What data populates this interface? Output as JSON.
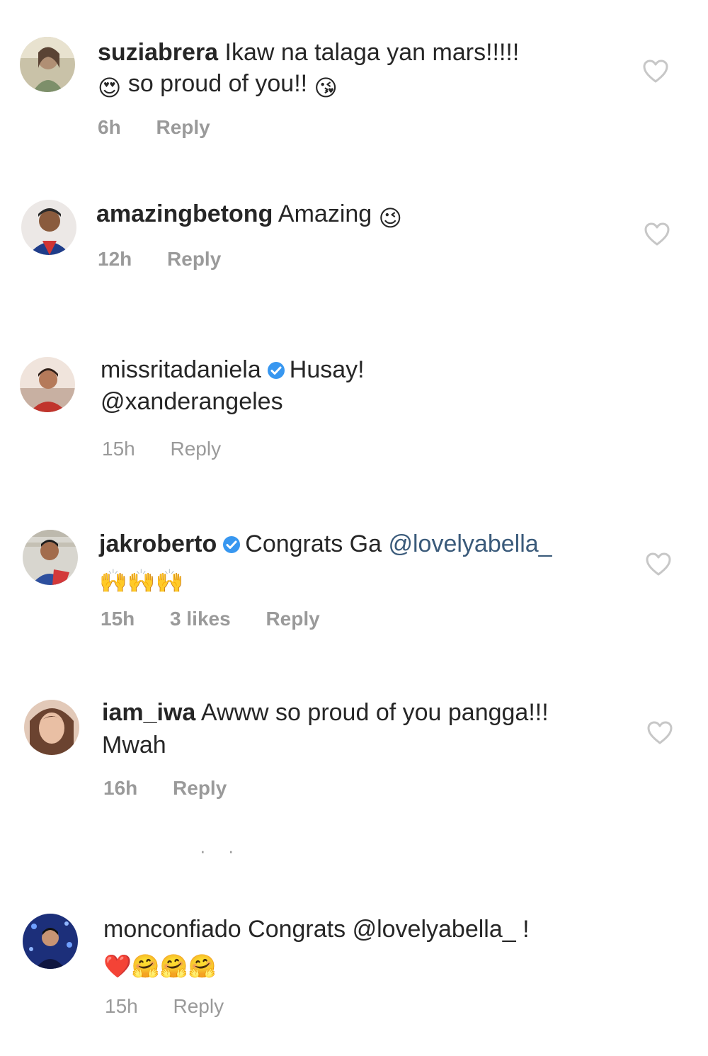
{
  "comments": [
    {
      "username": "suziabrera",
      "text_line1": "Ikaw na talaga yan mars!!!!!",
      "emoji_before": "😍",
      "text_line2": "so proud of you!!",
      "emoji_after": "😘",
      "time": "6h",
      "reply": "Reply"
    },
    {
      "username": "amazingbetong",
      "text_line1": "Amazing",
      "emoji_after": "😉",
      "time": "12h",
      "reply": "Reply"
    },
    {
      "username": "missritadaniela",
      "text_line1": "Husay!",
      "mention": "@xanderangeles",
      "time": "15h",
      "reply": "Reply"
    },
    {
      "username": "jakroberto",
      "text_line1": "Congrats Ga",
      "mention": "@lovelyabella_",
      "emoji_line2": "🙌🙌🙌",
      "time": "15h",
      "likes": "3 likes",
      "reply": "Reply"
    },
    {
      "username": "iam_iwa",
      "text_line1": "Awww so proud of you pangga!!!",
      "text_line2": "Mwah",
      "time": "16h",
      "reply": "Reply"
    },
    {
      "username": "monconfiado",
      "text_line1": "Congrats",
      "mention": "@lovelyabella_",
      "text_after_mention": " !",
      "emoji_line2": "❤️🤗🤗🤗",
      "time": "15h",
      "reply": "Reply"
    }
  ],
  "colors": {
    "text": "#262626",
    "meta": "#9a9a9a",
    "verified": "#3897f0",
    "heart_outline": "#c7c7c7"
  },
  "icons": {
    "like": "heart-outline-icon",
    "verified": "verified-badge-icon"
  }
}
